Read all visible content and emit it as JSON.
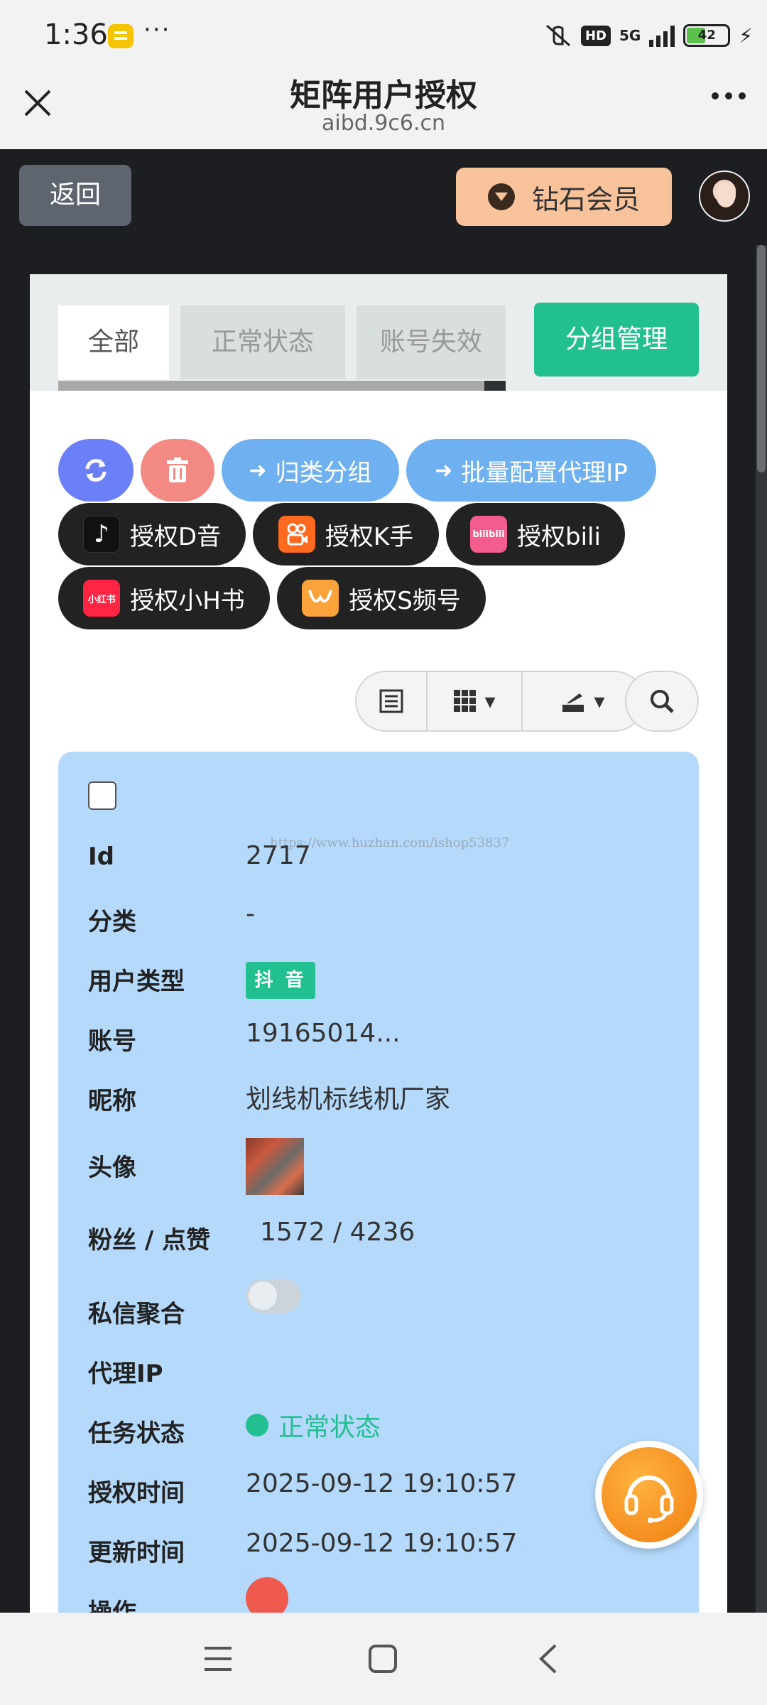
{
  "status_bar": {
    "time": "1:36",
    "dots": "···",
    "hd": "HD",
    "network": "5G",
    "battery": "42",
    "bolt": "⚡"
  },
  "header": {
    "title": "矩阵用户授权",
    "url": "aibd.9c6.cn"
  },
  "topbar": {
    "back_label": "返回",
    "vip_label": "钻石会员"
  },
  "tabs": {
    "all": "全部",
    "normal": "正常状态",
    "invalid": "账号失效",
    "group_manage": "分组管理"
  },
  "actions": {
    "group_label": "归类分组",
    "proxy_label": "批量配置代理IP",
    "platforms": {
      "douyin": {
        "label": "授权D音",
        "logo_text": "♪"
      },
      "kuaishou": {
        "label": "授权K手",
        "logo_text": ""
      },
      "bili": {
        "label": "授权bili",
        "logo_text": "bilibili"
      },
      "xhs": {
        "label": "授权小H书",
        "logo_text": "小红书"
      },
      "shipinhao": {
        "label": "授权S频号",
        "logo_text": ""
      }
    }
  },
  "record": {
    "labels": {
      "id": "Id",
      "category": "分类",
      "user_type": "用户类型",
      "account": "账号",
      "nickname": "昵称",
      "avatar": "头像",
      "fans_likes": "粉丝 / 点赞",
      "dm": "私信聚合",
      "proxy": "代理IP",
      "task_status": "任务状态",
      "auth_time": "授权时间",
      "update_time": "更新时间",
      "operation": "操作"
    },
    "values": {
      "id": "2717",
      "category": "-",
      "user_type": "抖 音",
      "account": "19165014...",
      "nickname": "划线机标线机厂家",
      "fans_likes": "1572 / 4236",
      "dm_enabled": false,
      "proxy": "",
      "task_status": "正常状态",
      "auth_time": "2025-09-12 19:10:57",
      "update_time": "2025-09-12 19:10:57"
    },
    "watermark": "https://www.huzhan.com/ishop53837"
  },
  "colors": {
    "accent_green": "#22bf91",
    "record_bg": "#b4d9fb",
    "vip": "#f8c39a",
    "blue_pill": "#6fb1f0"
  }
}
